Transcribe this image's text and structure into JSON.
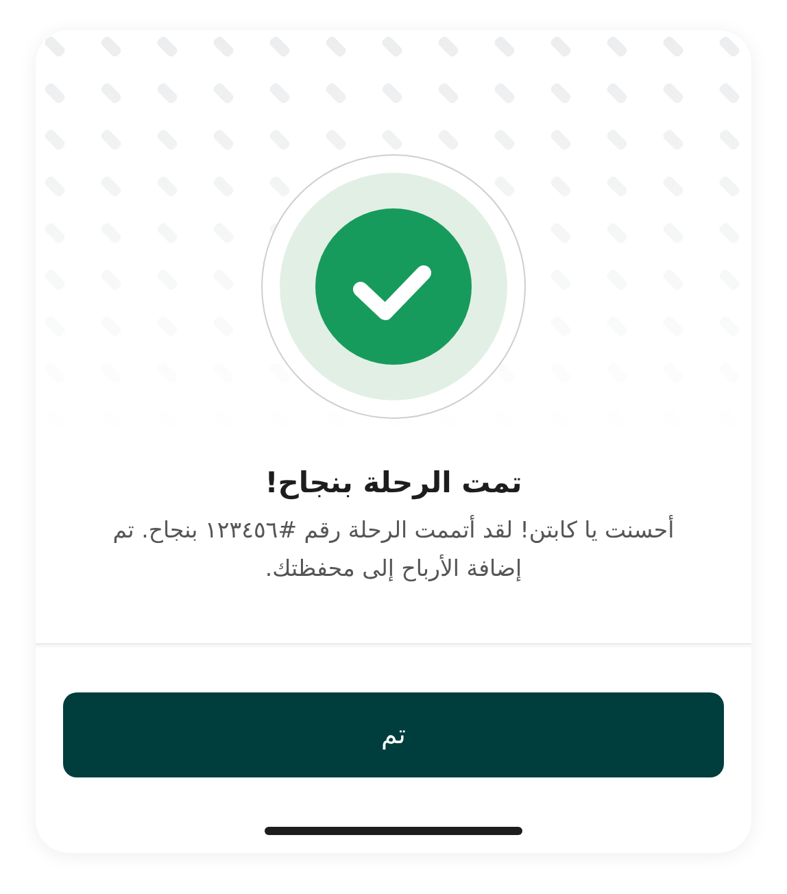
{
  "dialog": {
    "title": "تمت الرحلة بنجاح!",
    "message": "أحسنت يا كابتن! لقد أتممت الرحلة رقم #١٢٣٤٥٦ بنجاح. تم إضافة الأرباح إلى محفظتك.",
    "button": "تم"
  }
}
